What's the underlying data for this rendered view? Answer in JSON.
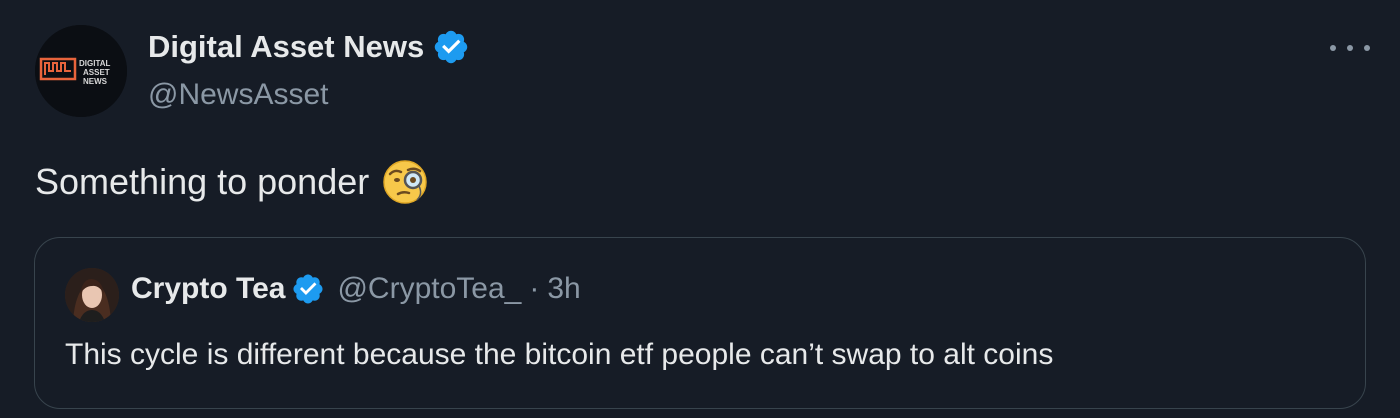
{
  "tweet": {
    "author": {
      "name": "Digital Asset News",
      "handle": "@NewsAsset",
      "avatar_icon": "digital-asset-news-logo",
      "avatar_text": [
        "DIGITAL",
        "ASSET",
        "NEWS"
      ],
      "verified": true
    },
    "text": "Something to ponder",
    "emoji": "face-with-monocle",
    "more_icon": "more-options-icon"
  },
  "quote": {
    "author": {
      "name": "Crypto Tea",
      "handle": "@CryptoTea_",
      "verified": true,
      "avatar_icon": "user-avatar"
    },
    "separator": "·",
    "time": "3h",
    "text": "This cycle is different because the bitcoin etf people can’t swap to alt coins"
  },
  "colors": {
    "background": "#161c26",
    "text_primary": "#e7e9ea",
    "text_secondary": "#8b98a5",
    "verified_blue": "#1d9bf0",
    "border": "#38444d",
    "logo_accent": "#e8643c"
  }
}
